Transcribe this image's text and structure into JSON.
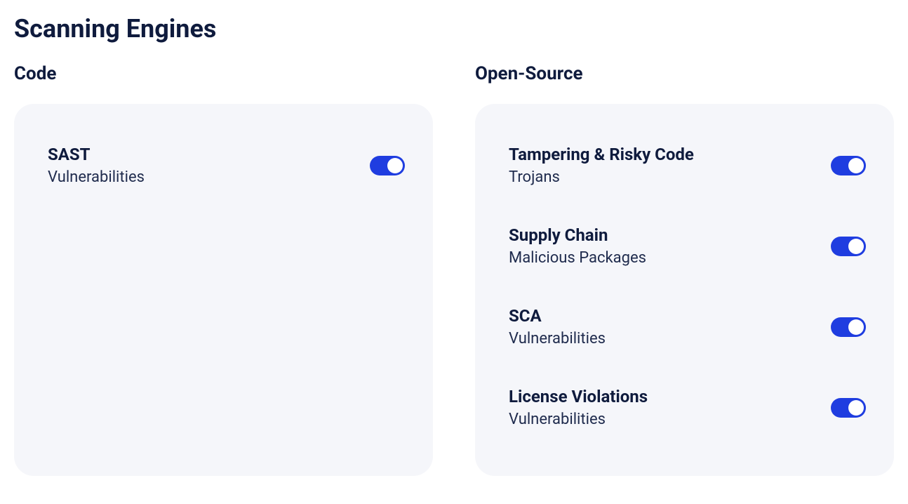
{
  "title": "Scanning Engines",
  "columns": {
    "code": {
      "heading": "Code",
      "engines": [
        {
          "name": "SAST",
          "desc": "Vulnerabilities",
          "enabled": true
        }
      ]
    },
    "openSource": {
      "heading": "Open-Source",
      "engines": [
        {
          "name": "Tampering & Risky Code",
          "desc": "Trojans",
          "enabled": true
        },
        {
          "name": "Supply Chain",
          "desc": "Malicious Packages",
          "enabled": true
        },
        {
          "name": "SCA",
          "desc": "Vulnerabilities",
          "enabled": true
        },
        {
          "name": "License Violations",
          "desc": "Vulnerabilities",
          "enabled": true
        }
      ]
    }
  }
}
